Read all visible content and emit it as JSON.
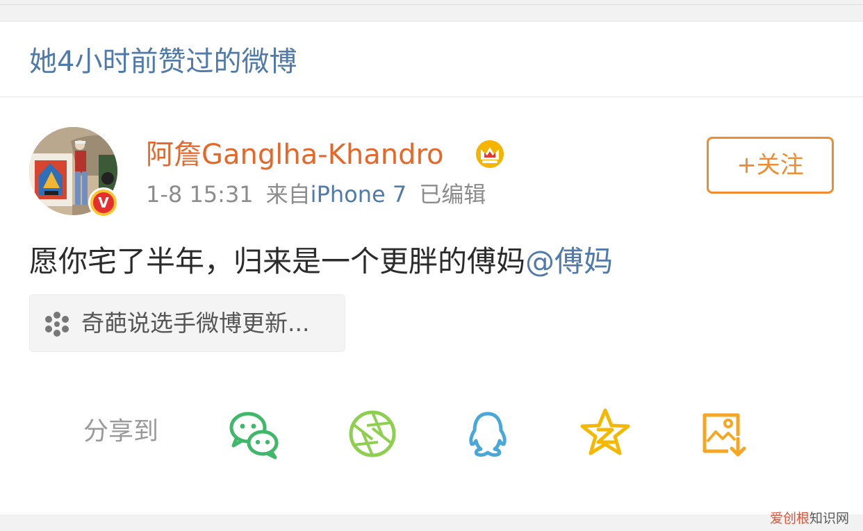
{
  "liked_header": {
    "title": "她4小时前赞过的微博"
  },
  "post": {
    "author": {
      "name": "阿詹Ganglha-Khandro",
      "badge_letter": "V",
      "crown_icon": "vip-crown-icon"
    },
    "meta": {
      "time": "1-8 15:31",
      "source_prefix": "来自",
      "source_device": "iPhone 7",
      "edited": "已编辑"
    },
    "follow_button": {
      "label": "+关注"
    },
    "text": {
      "body": "愿你宅了半年，归来是一个更胖的傅妈",
      "mention": "@傅妈"
    },
    "topic_card": {
      "icon": "topic-pinwheel-icon",
      "label": "奇葩说选手微博更新..."
    }
  },
  "share_bar": {
    "label": "分享到",
    "targets": [
      {
        "name": "wechat",
        "icon": "wechat-icon",
        "color": "#3fb86a"
      },
      {
        "name": "moments",
        "icon": "moments-icon",
        "color": "#8fcf4f"
      },
      {
        "name": "qq",
        "icon": "qq-icon",
        "color": "#4aa8d8"
      },
      {
        "name": "qzone",
        "icon": "qzone-icon",
        "color": "#f5b800"
      },
      {
        "name": "save-image",
        "icon": "save-image-icon",
        "color": "#f5a623"
      }
    ]
  },
  "watermark": {
    "brand": "爱创根",
    "rest": "知识网"
  },
  "colors": {
    "link_blue": "#4f7aaa",
    "username_orange": "#e5682a",
    "follow_orange": "#f08c2f",
    "meta_gray": "#8c8c8c"
  }
}
